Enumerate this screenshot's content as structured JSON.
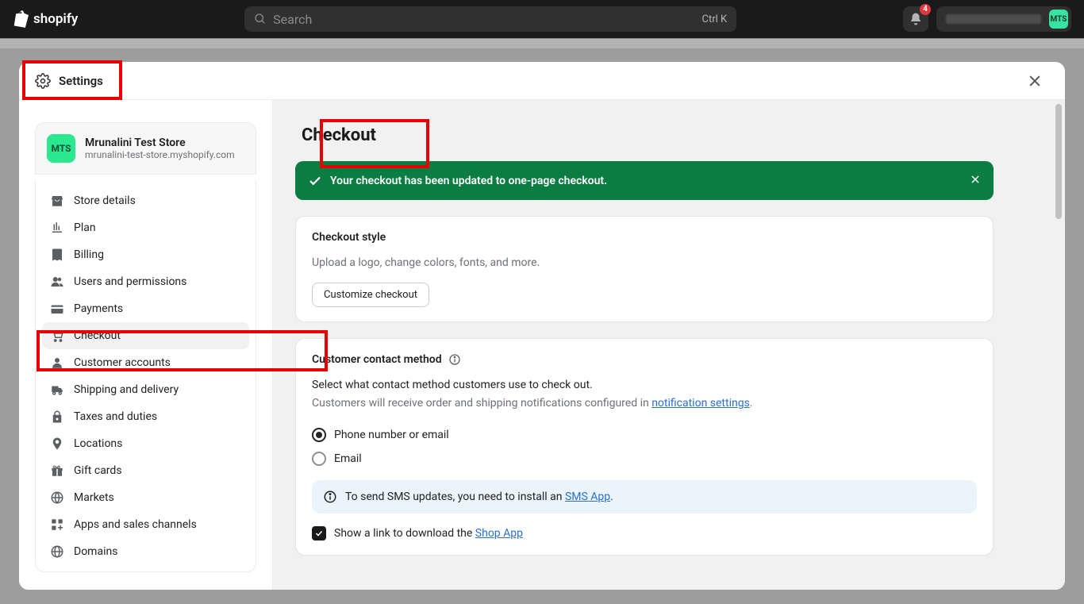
{
  "topbar": {
    "brand": "shopify",
    "search_placeholder": "Search",
    "search_kbd": "Ctrl K",
    "notif_count": "4",
    "avatar_initials": "MTS"
  },
  "modal": {
    "title": "Settings"
  },
  "store": {
    "name": "Mrunalini Test Store",
    "url": "mrunalini-test-store.myshopify.com",
    "initials": "MTS"
  },
  "nav": {
    "items": [
      {
        "label": "Store details"
      },
      {
        "label": "Plan"
      },
      {
        "label": "Billing"
      },
      {
        "label": "Users and permissions"
      },
      {
        "label": "Payments"
      },
      {
        "label": "Checkout"
      },
      {
        "label": "Customer accounts"
      },
      {
        "label": "Shipping and delivery"
      },
      {
        "label": "Taxes and duties"
      },
      {
        "label": "Locations"
      },
      {
        "label": "Gift cards"
      },
      {
        "label": "Markets"
      },
      {
        "label": "Apps and sales channels"
      },
      {
        "label": "Domains"
      }
    ]
  },
  "page": {
    "title": "Checkout",
    "success_banner": "Your checkout has been updated to one-page checkout.",
    "card_style": {
      "heading": "Checkout style",
      "desc": "Upload a logo, change colors, fonts, and more.",
      "button": "Customize checkout"
    },
    "card_contact": {
      "heading": "Customer contact method",
      "desc1": "Select what contact method customers use to check out.",
      "desc2_prefix": "Customers will receive order and shipping notifications configured in ",
      "desc2_link": "notification settings",
      "radio1": "Phone number or email",
      "radio2": "Email",
      "info_prefix": "To send SMS updates, you need to install an ",
      "info_link": "SMS App",
      "check_prefix": "Show a link to download the ",
      "check_link": "Shop App"
    }
  }
}
